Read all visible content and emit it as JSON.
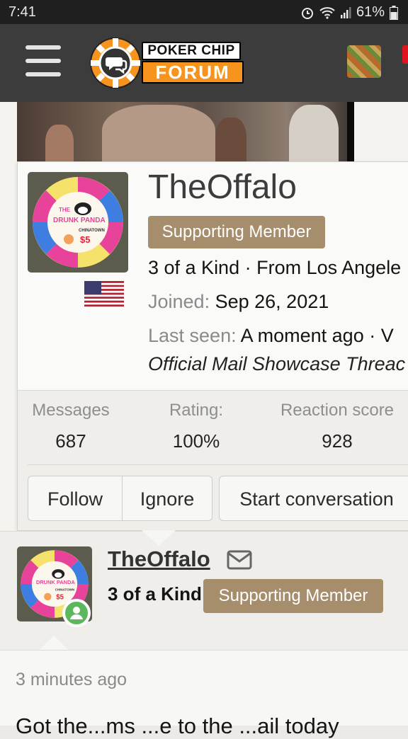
{
  "status_bar": {
    "time": "7:41",
    "battery": "61%"
  },
  "header": {
    "logo_line1": "POKER CHIP",
    "logo_line2": "FORUM",
    "brand_color": "#f7941d"
  },
  "member_card": {
    "username": "TheOffalo",
    "badge": "Supporting Member",
    "user_title": "3 of a Kind",
    "location": "From Los Angele",
    "joined_label": "Joined:",
    "joined_value": "Sep 26, 2021",
    "last_seen_label": "Last seen:",
    "last_seen_value": "A moment ago",
    "last_seen_suffix": "V",
    "activity_thread": "Official Mail Showcase Threac",
    "avatar_chip": {
      "line1": "THE",
      "line2": "DRUNK PANDA",
      "line3": "CHINATOWN",
      "value": "$5"
    },
    "stats": [
      {
        "label": "Messages",
        "value": "687"
      },
      {
        "label": "Rating:",
        "value": "100%"
      },
      {
        "label": "Reaction score",
        "value": "928"
      }
    ],
    "buttons": {
      "follow": "Follow",
      "ignore": "Ignore",
      "start_conversation": "Start conversation"
    }
  },
  "post": {
    "username": "TheOffalo",
    "user_title": "3 of a Kind",
    "badge": "Supporting Member",
    "timestamp": "3 minutes ago",
    "body_text": "Got the...ms ...e to the ...ail today"
  },
  "colors": {
    "badge": "#a68d6c",
    "header": "#3c3c3c",
    "online": "#5cb85c"
  }
}
